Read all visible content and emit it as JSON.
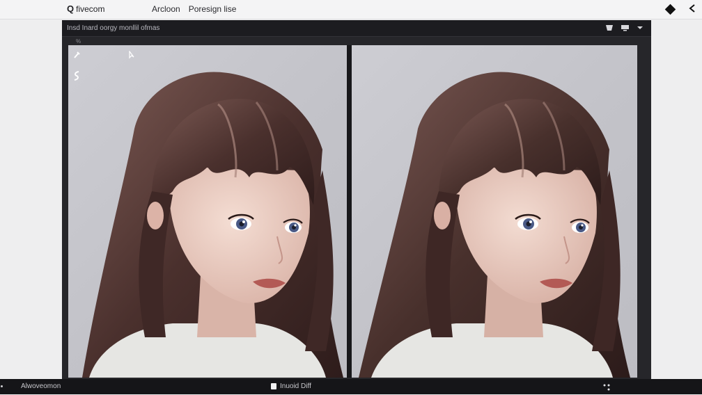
{
  "app": {
    "brand": "fivecom",
    "brand_glyph": "Q"
  },
  "menu": {
    "items": [
      "Arcloon",
      "Poresign lise"
    ]
  },
  "viewer": {
    "title": "Insd Inard oorgy monllil ofmas",
    "sub": "%"
  },
  "status": {
    "left_text": "Alwoveomon",
    "center_text": "Inuoid Diff"
  },
  "colors": {
    "hair_dark": "#3b2624",
    "hair_mid": "#5e3f3a",
    "hair_light": "#8a6a63",
    "skin": "#eccfc4",
    "eye": "#4a5a86",
    "lip": "#b35a55",
    "sweater": "#e6e6e3"
  },
  "icons": {
    "top_right": [
      "diamond-icon",
      "chevron-left-icon"
    ],
    "viewer_controls": [
      "cup-icon",
      "monitor-icon",
      "caret-down-icon"
    ],
    "panel_tools": [
      "pen-icon",
      "curve-icon",
      "cursor-icon"
    ],
    "status": [
      "checkbox-icon",
      "grid-dots-icon"
    ]
  }
}
